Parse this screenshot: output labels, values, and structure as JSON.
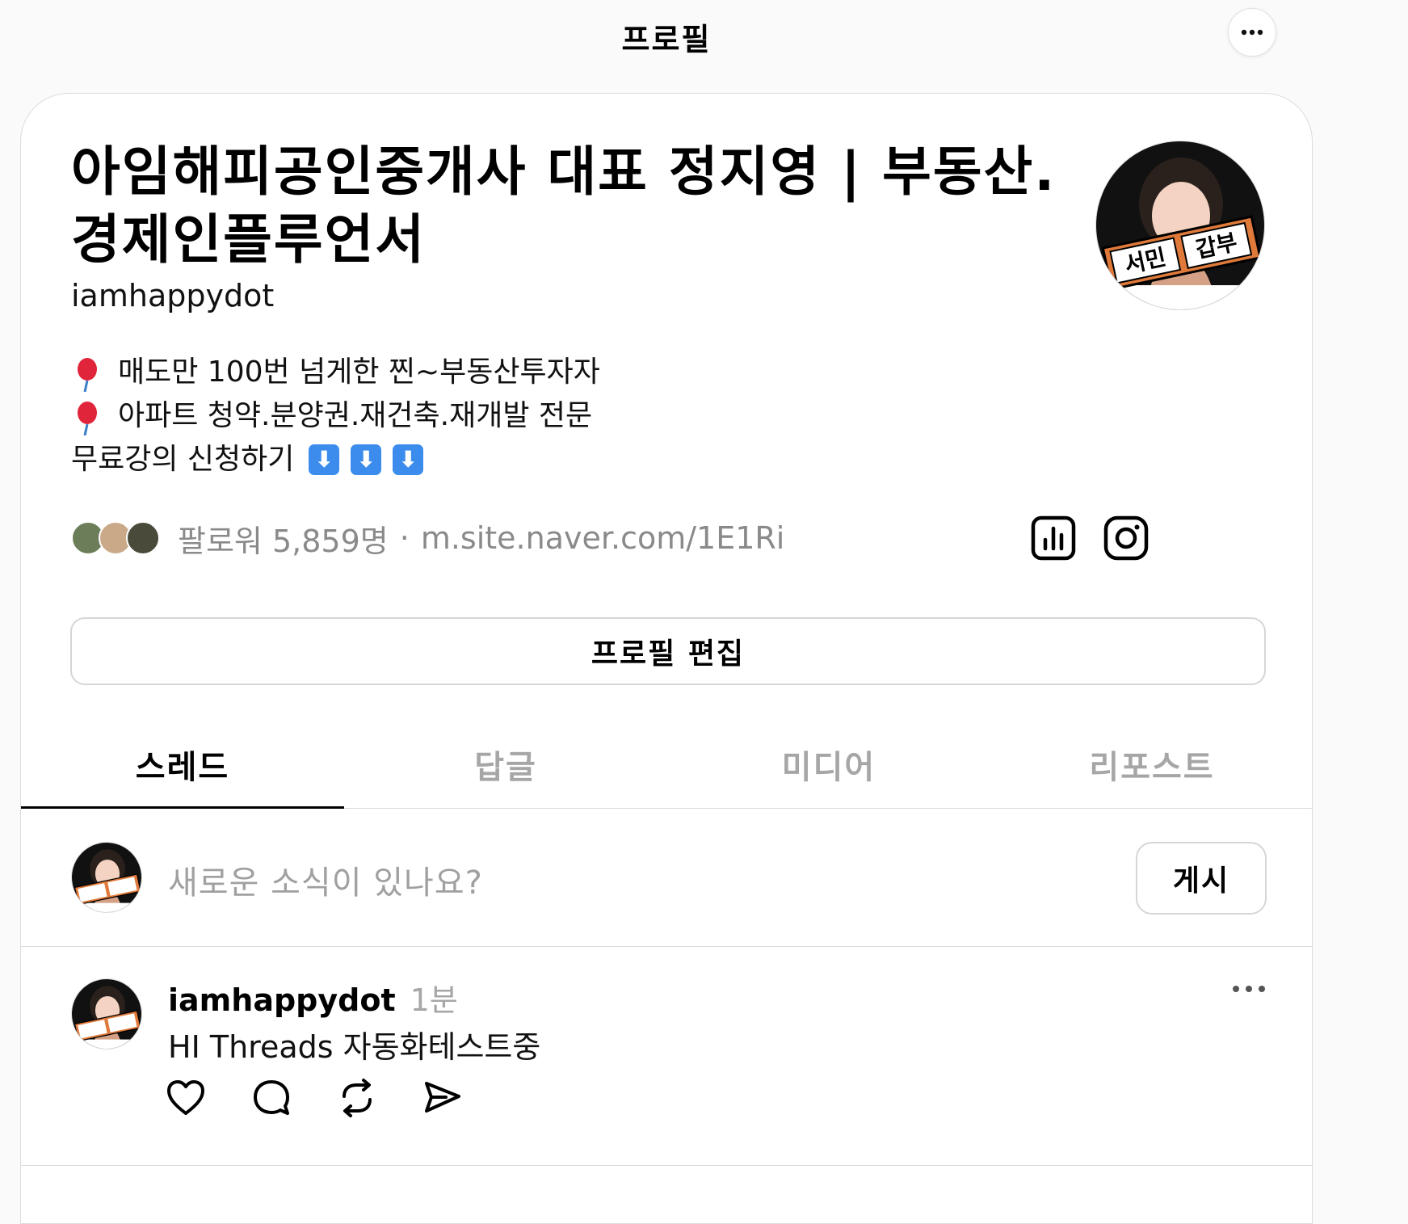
{
  "header": {
    "title": "프로필",
    "more_icon": "more-horizontal-icon"
  },
  "profile": {
    "display_name": "아임해피공인중개사 대표 정지영 | 부동산. 경제인플루언서",
    "username": "iamhappydot",
    "avatar_sign_text": "서민 갑부",
    "bio_lines": [
      "매도만 100번 넘게한 찐~부동산투자자",
      "아파트 청약.분양권.재건축.재개발 전문",
      "무료강의 신청하기"
    ],
    "bio_icons": [
      "balloon-pin-icon",
      "down-arrow-emoji-icon"
    ],
    "followers": "팔로워 5,859명",
    "separator": "·",
    "link": "m.site.naver.com/1E1Ri",
    "insights_icon": "insights-bar-chart-icon",
    "instagram_icon": "instagram-icon",
    "edit_button": "프로필 편집"
  },
  "tabs": [
    {
      "label": "스레드",
      "active": true
    },
    {
      "label": "답글",
      "active": false
    },
    {
      "label": "미디어",
      "active": false
    },
    {
      "label": "리포스트",
      "active": false
    }
  ],
  "composer": {
    "placeholder": "새로운 소식이 있나요?",
    "post_button": "게시"
  },
  "post": {
    "author": "iamhappydot",
    "time": "1분",
    "text": "HI Threads 자동화테스트중",
    "more_icon": "more-horizontal-icon",
    "action_icons": [
      "heart-icon",
      "comment-icon",
      "repost-icon",
      "share-icon"
    ]
  },
  "colors": {
    "background": "#fafafa",
    "card": "#ffffff",
    "muted_text": "#a6a6a6",
    "border": "#dbdbdb",
    "emoji_blue": "#3b8ced",
    "balloon_red": "#e0243a"
  }
}
